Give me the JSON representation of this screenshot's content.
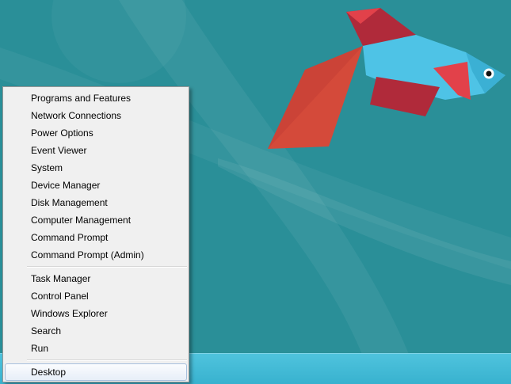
{
  "context_menu": {
    "groups": [
      {
        "items": [
          {
            "label": "Programs and Features"
          },
          {
            "label": "Network Connections"
          },
          {
            "label": "Power Options"
          },
          {
            "label": "Event Viewer"
          },
          {
            "label": "System"
          },
          {
            "label": "Device Manager"
          },
          {
            "label": "Disk Management"
          },
          {
            "label": "Computer Management"
          },
          {
            "label": "Command Prompt"
          },
          {
            "label": "Command Prompt (Admin)"
          }
        ]
      },
      {
        "items": [
          {
            "label": "Task Manager"
          },
          {
            "label": "Control Panel"
          },
          {
            "label": "Windows Explorer"
          },
          {
            "label": "Search"
          },
          {
            "label": "Run"
          }
        ]
      },
      {
        "items": [
          {
            "label": "Desktop",
            "highlighted": true
          }
        ]
      }
    ]
  },
  "wallpaper": {
    "subject": "betta-fish",
    "colors": {
      "background": "#2a8f98",
      "fish_body": "#4ec3e6",
      "fish_fins": "#b02a3a",
      "fish_tail": "#d44a3a"
    }
  },
  "taskbar": {
    "color": "#45bcd8"
  }
}
